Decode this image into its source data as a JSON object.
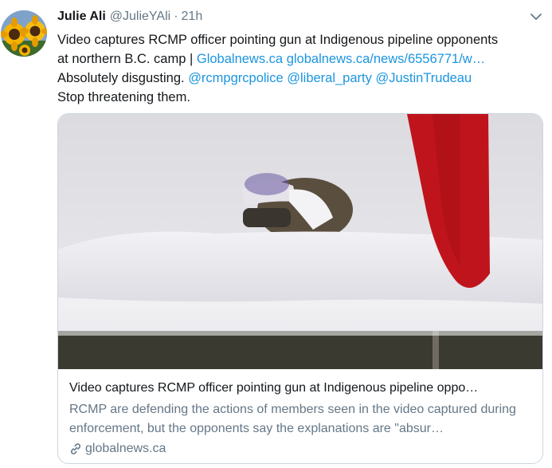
{
  "tweet": {
    "author_name": "Julie Ali",
    "author_handle": "@JulieYAli",
    "separator": "·",
    "timestamp": "21h",
    "text_line1": "Video captures RCMP officer pointing gun at Indigenous pipeline opponents",
    "text_line2_plain": "at northern B.C. camp | ",
    "text_link1": "Globalnews.ca",
    "text_link2": "globalnews.ca/news/6556771/w…",
    "text_line3_plain": " Absolutely disgusting. ",
    "mention1": "@rcmpgrcpolice",
    "mention2": "@liberal_party",
    "mention3": "@JustinTrudeau",
    "text_line4": "Stop threatening them."
  },
  "card": {
    "title": "Video captures RCMP officer pointing gun at Indigenous pipeline oppo…",
    "description": "RCMP are defending the actions of members seen in the video captured during enforcement, but the opponents say the explanations are \"absur…",
    "domain": "globalnews.ca"
  },
  "icons": {
    "more": "chevron-down-icon",
    "link": "link-icon"
  },
  "colors": {
    "link": "#1b95e0",
    "secondary_text": "#657786",
    "border": "#ccd6dd",
    "flag_red": "#c0141c"
  }
}
